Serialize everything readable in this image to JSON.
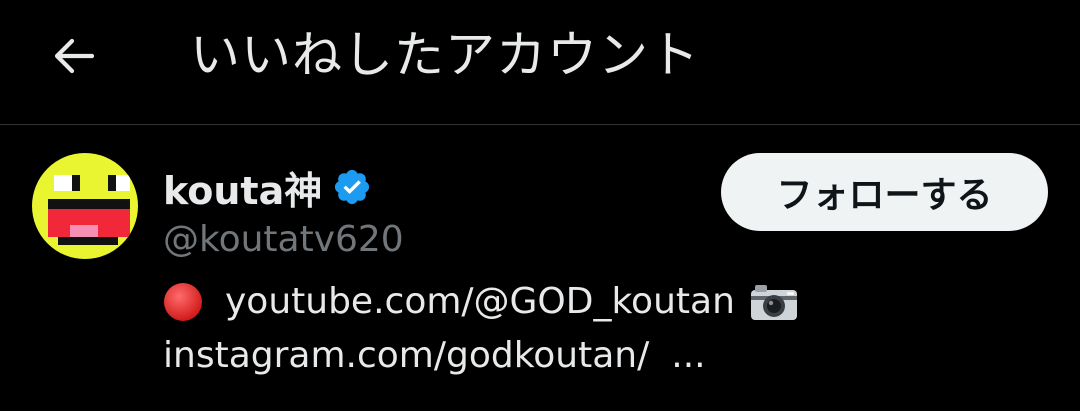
{
  "header": {
    "back_icon": "arrow-left-icon",
    "title": "いいねしたアカウント"
  },
  "user": {
    "avatar_icon": "pixel-face-avatar",
    "display_name": "kouta神",
    "verified_icon": "verified-badge-icon",
    "handle": "@koutatv620",
    "follow_label": "フォローする",
    "bio": {
      "line1_emoji": "red-circle-emoji",
      "line1_link": "youtube.com/@GOD_koutan",
      "line1_trailing_emoji": "camera-emoji",
      "line2_link": "instagram.com/godkoutan/",
      "line2_ellipsis": "..."
    }
  },
  "colors": {
    "background": "#000000",
    "text_primary": "#e7e9ea",
    "text_secondary": "#71767b",
    "verified_blue": "#1d9bf0",
    "follow_button_bg": "#eff3f4",
    "divider": "#2f3336",
    "avatar_yellow": "#e8f530",
    "avatar_mouth_red": "#f0283a",
    "avatar_tongue_pink": "#f590b4"
  }
}
